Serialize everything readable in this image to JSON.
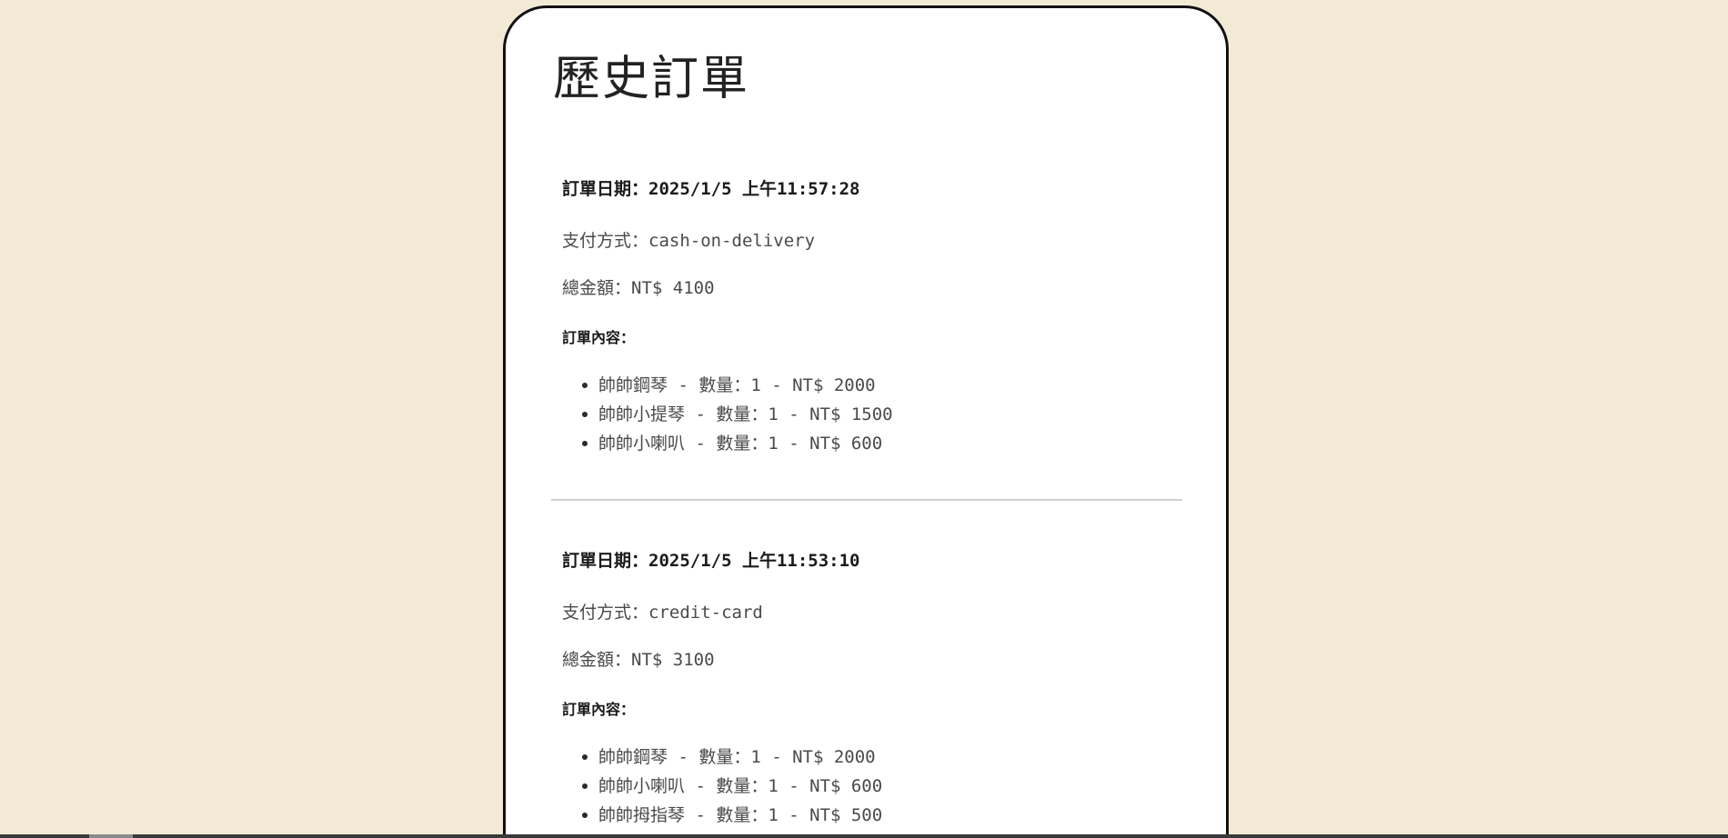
{
  "page": {
    "title": "歷史訂單"
  },
  "orders": [
    {
      "date_label": "訂單日期：",
      "date": "2025/1/5 上午11:57:28",
      "payment_label": "支付方式：",
      "payment": "cash-on-delivery",
      "total_label": "總金額：",
      "total": "NT$ 4100",
      "items_label": "訂單內容：",
      "items": [
        {
          "text": "帥帥鋼琴 - 數量：1 - NT$ 2000"
        },
        {
          "text": "帥帥小提琴 - 數量：1 - NT$ 1500"
        },
        {
          "text": "帥帥小喇叭 - 數量：1 - NT$ 600"
        }
      ]
    },
    {
      "date_label": "訂單日期：",
      "date": "2025/1/5 上午11:53:10",
      "payment_label": "支付方式：",
      "payment": "credit-card",
      "total_label": "總金額：",
      "total": "NT$ 3100",
      "items_label": "訂單內容：",
      "items": [
        {
          "text": "帥帥鋼琴 - 數量：1 - NT$ 2000"
        },
        {
          "text": "帥帥小喇叭 - 數量：1 - NT$ 600"
        },
        {
          "text": "帥帥拇指琴 - 數量：1 - NT$ 500"
        }
      ]
    }
  ],
  "colors": {
    "page_background": "#f3ead6",
    "card_background": "#ffffff",
    "card_border": "#111111",
    "separator": "#cfcfcf"
  }
}
